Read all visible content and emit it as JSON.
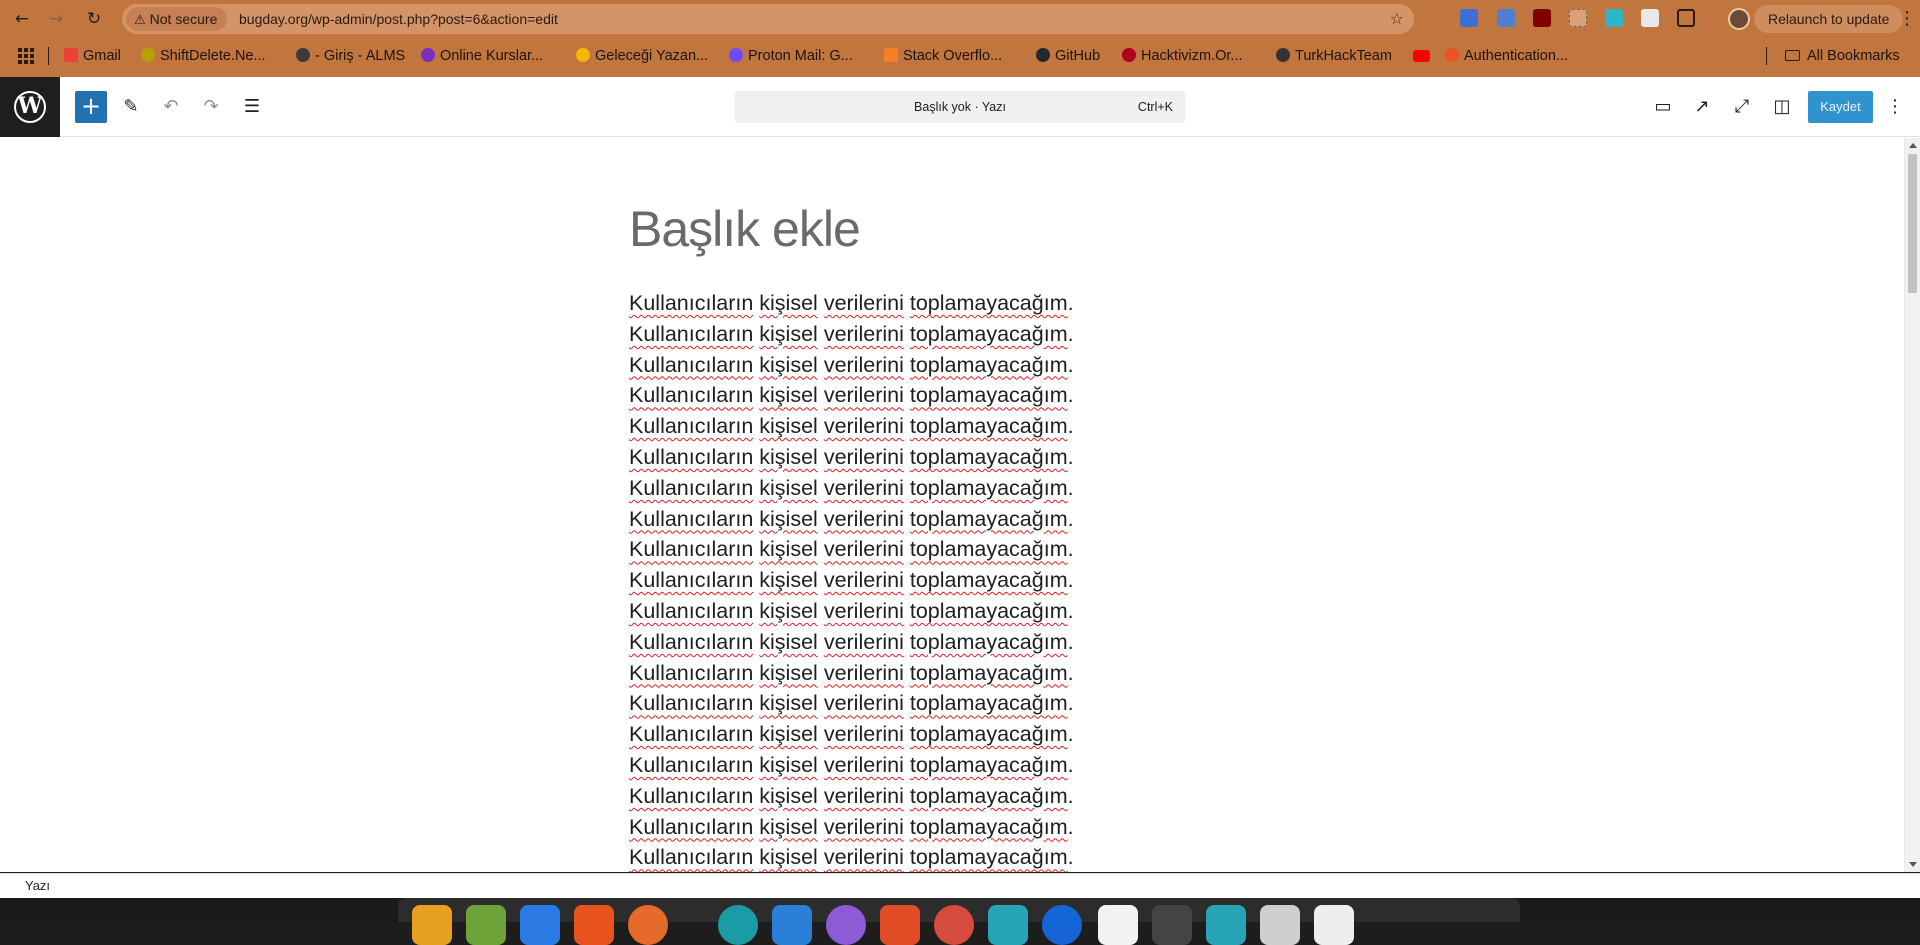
{
  "browser": {
    "not_secure": "Not secure",
    "url": "bugday.org/wp-admin/post.php?post=6&action=edit",
    "relaunch": "Relaunch to update",
    "bookmarks": [
      {
        "label": "Gmail",
        "color": "#ea4335"
      },
      {
        "label": "ShiftDelete.Ne...",
        "color": "#2b2b2b"
      },
      {
        "label": "- Giriş - ALMS",
        "color": "#3a3a3a"
      },
      {
        "label": "Online Kurslar...",
        "color": "#7b2fbe"
      },
      {
        "label": "Geleceği Yazan...",
        "color": "#f5b800"
      },
      {
        "label": "Proton Mail: G...",
        "color": "#6d4aff"
      },
      {
        "label": "Stack Overflo...",
        "color": "#f48024"
      },
      {
        "label": "GitHub",
        "color": "#24292f"
      },
      {
        "label": "Hacktivizm.Or...",
        "color": "#b00020"
      },
      {
        "label": "TurkHackTeam",
        "color": "#333333"
      },
      {
        "label": "",
        "color": "#ff0000"
      },
      {
        "label": "Authentication...",
        "color": "#eb5424"
      }
    ],
    "all_bookmarks": "All Bookmarks"
  },
  "editor": {
    "command_title": "Başlık yok · Yazı",
    "command_shortcut": "Ctrl+K",
    "save_label": "Kaydet",
    "title_placeholder": "Başlık ekle",
    "paragraph_words": [
      "Kullanıcıların",
      "kişisel",
      "verilerini",
      "toplamayacağım"
    ],
    "paragraph_line_count": 19,
    "breadcrumb": "Yazı"
  },
  "colors": {
    "chrome": "#c1763f",
    "accent": "#3192d0",
    "spell_underline": "#e02020"
  }
}
